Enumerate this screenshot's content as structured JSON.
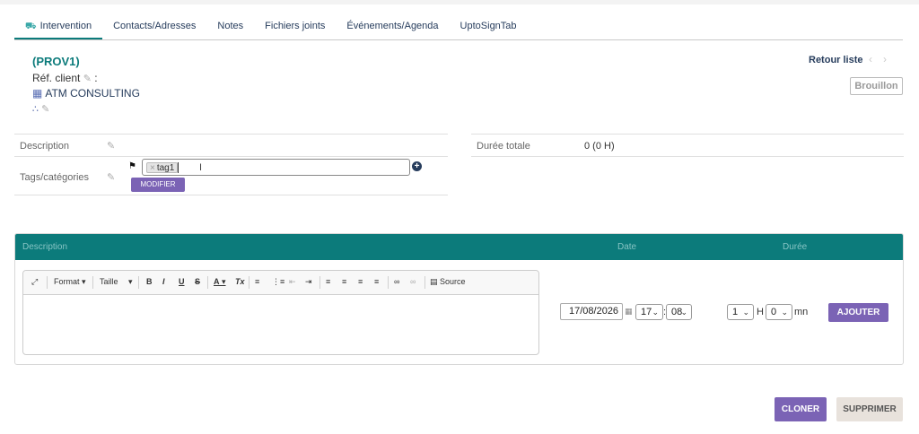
{
  "tabs": [
    {
      "label": "Intervention",
      "icon": "truck-icon",
      "active": true
    },
    {
      "label": "Contacts/Adresses"
    },
    {
      "label": "Notes"
    },
    {
      "label": "Fichiers joints"
    },
    {
      "label": "Événements/Agenda"
    },
    {
      "label": "UptoSignTab"
    }
  ],
  "header": {
    "ref": "(PROV1)",
    "ref_client_label": "Réf. client",
    "ref_client_suffix": ":",
    "company": "ATM CONSULTING",
    "retour_liste": "Retour liste",
    "status": "Brouillon"
  },
  "fields": {
    "description_label": "Description",
    "tags_label": "Tags/catégories",
    "tag_chip": "tag1",
    "tag_chip_remove": "×",
    "modifier_label": "MODIFIER",
    "duree_totale_label": "Durée totale",
    "duree_totale_value": "0 (0 H)"
  },
  "panel": {
    "col_description": "Description",
    "col_date": "Date",
    "col_duree": "Durée",
    "toolbar": {
      "format": "Format",
      "taille": "Taille",
      "bold": "B",
      "italic": "I",
      "underline": "U",
      "strike": "S",
      "font_color": "A",
      "clear_format": "Tx",
      "source": "Source"
    },
    "date_value": "17/08/2026",
    "hour_value": "17",
    "time_sep": ":",
    "minute_value": "08",
    "duration_hours": "1",
    "hours_unit": "H",
    "duration_minutes": "0",
    "minutes_unit": "mn",
    "ajouter_label": "AJOUTER"
  },
  "actions": {
    "cloner": "CLONER",
    "supprimer": "SUPPRIMER"
  },
  "colors": {
    "accent": "#0c7b7b",
    "button": "#7b63b5",
    "navy": "#263c5c"
  }
}
